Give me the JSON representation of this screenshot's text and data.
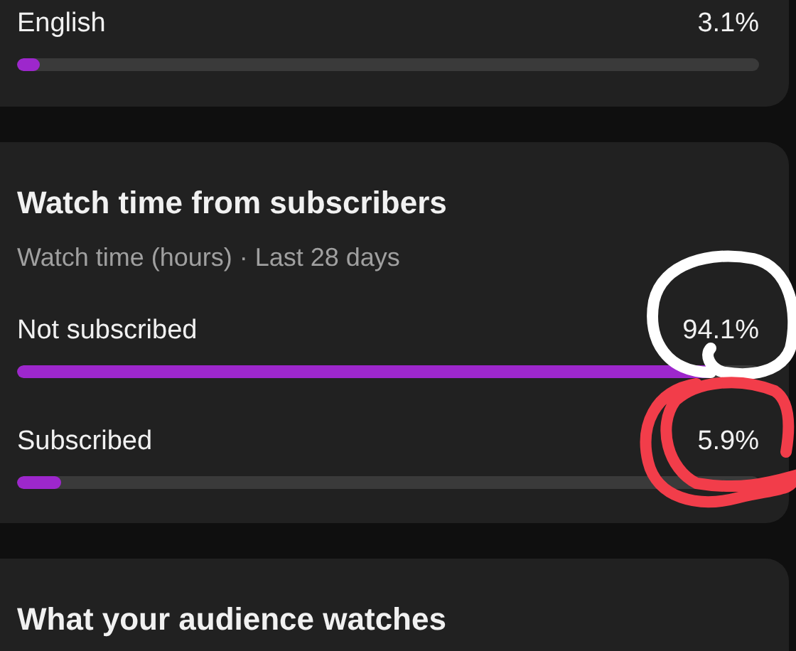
{
  "top_card": {
    "rows": [
      {
        "label": "English",
        "value": "3.1%",
        "level": 0.031
      }
    ]
  },
  "subscribers_card": {
    "title": "Watch time from subscribers",
    "subtitle": "Watch time (hours) · Last 28 days",
    "rows": [
      {
        "label": "Not subscribed",
        "value": "94.1%",
        "level": 0.941
      },
      {
        "label": "Subscribed",
        "value": "5.9%",
        "level": 0.059
      }
    ]
  },
  "audience_card": {
    "title": "What your audience watches"
  }
}
